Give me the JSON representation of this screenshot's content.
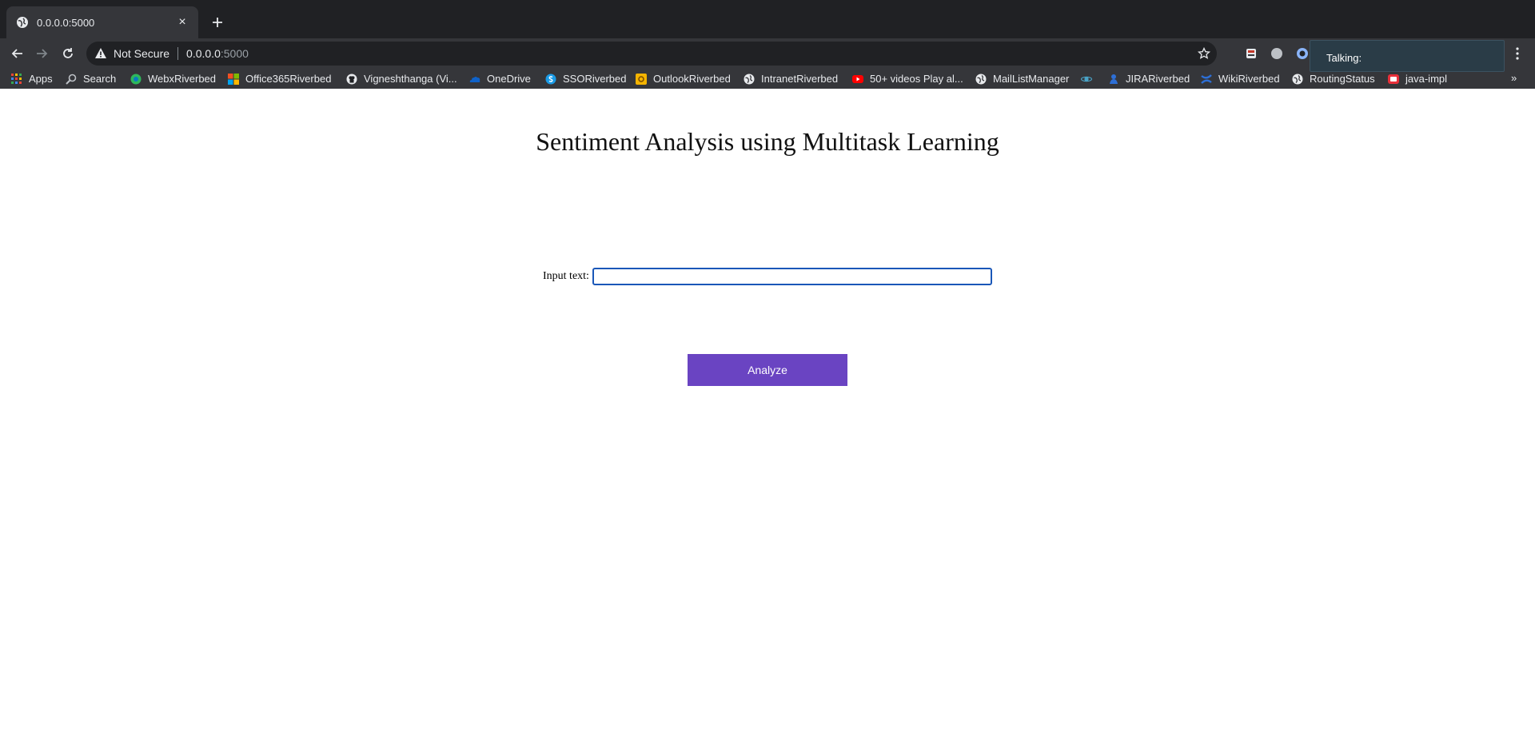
{
  "browser": {
    "tab": {
      "title": "0.0.0.0:5000",
      "close": "×",
      "new_tab": "+"
    },
    "omnibox": {
      "security_text": "Not Secure",
      "url_host": "0.0.0.0",
      "url_port": ":5000"
    },
    "popup": {
      "text": "Talking:"
    },
    "bookmarks": [
      {
        "label": "Apps",
        "icon": "apps-grid-icon",
        "color": "#f4b400"
      },
      {
        "label": "Search",
        "icon": "search-icon",
        "color": "#9aa0a6"
      },
      {
        "label": "WebxRiverbed",
        "icon": "webex-icon",
        "color": "#2eb85c"
      },
      {
        "label": "Office365Riverbed",
        "icon": "microsoft-icon",
        "color": "#f25022"
      },
      {
        "label": "Vigneshthanga (Vi...",
        "icon": "github-icon",
        "color": "#e8eaed"
      },
      {
        "label": "OneDrive",
        "icon": "onedrive-icon",
        "color": "#0f62c9"
      },
      {
        "label": "SSORiverbed",
        "icon": "sso-icon",
        "color": "#1a9be6"
      },
      {
        "label": "OutlookRiverbed",
        "icon": "outlook-icon",
        "color": "#f4b400"
      },
      {
        "label": "IntranetRiverbed",
        "icon": "globe-icon",
        "color": "#e8eaed"
      },
      {
        "label": "50+ videos Play al...",
        "icon": "youtube-icon",
        "color": "#ff0000"
      },
      {
        "label": "MailListManager",
        "icon": "globe-icon",
        "color": "#e8eaed"
      },
      {
        "label": "",
        "icon": "planet-icon",
        "color": "#4aa3c7"
      },
      {
        "label": "JIRARiverbed",
        "icon": "jira-icon",
        "color": "#2d6fd6"
      },
      {
        "label": "WikiRiverbed",
        "icon": "confluence-icon",
        "color": "#2d6fd6"
      },
      {
        "label": "RoutingStatus",
        "icon": "globe-icon",
        "color": "#e8eaed"
      },
      {
        "label": "java-impl",
        "icon": "bookmark-red-icon",
        "color": "#e8303a"
      }
    ],
    "more_bookmarks": "»"
  },
  "page": {
    "title": "Sentiment Analysis using Multitask Learning",
    "input_label": "Input text:",
    "input_value": "",
    "button_label": "Analyze"
  }
}
